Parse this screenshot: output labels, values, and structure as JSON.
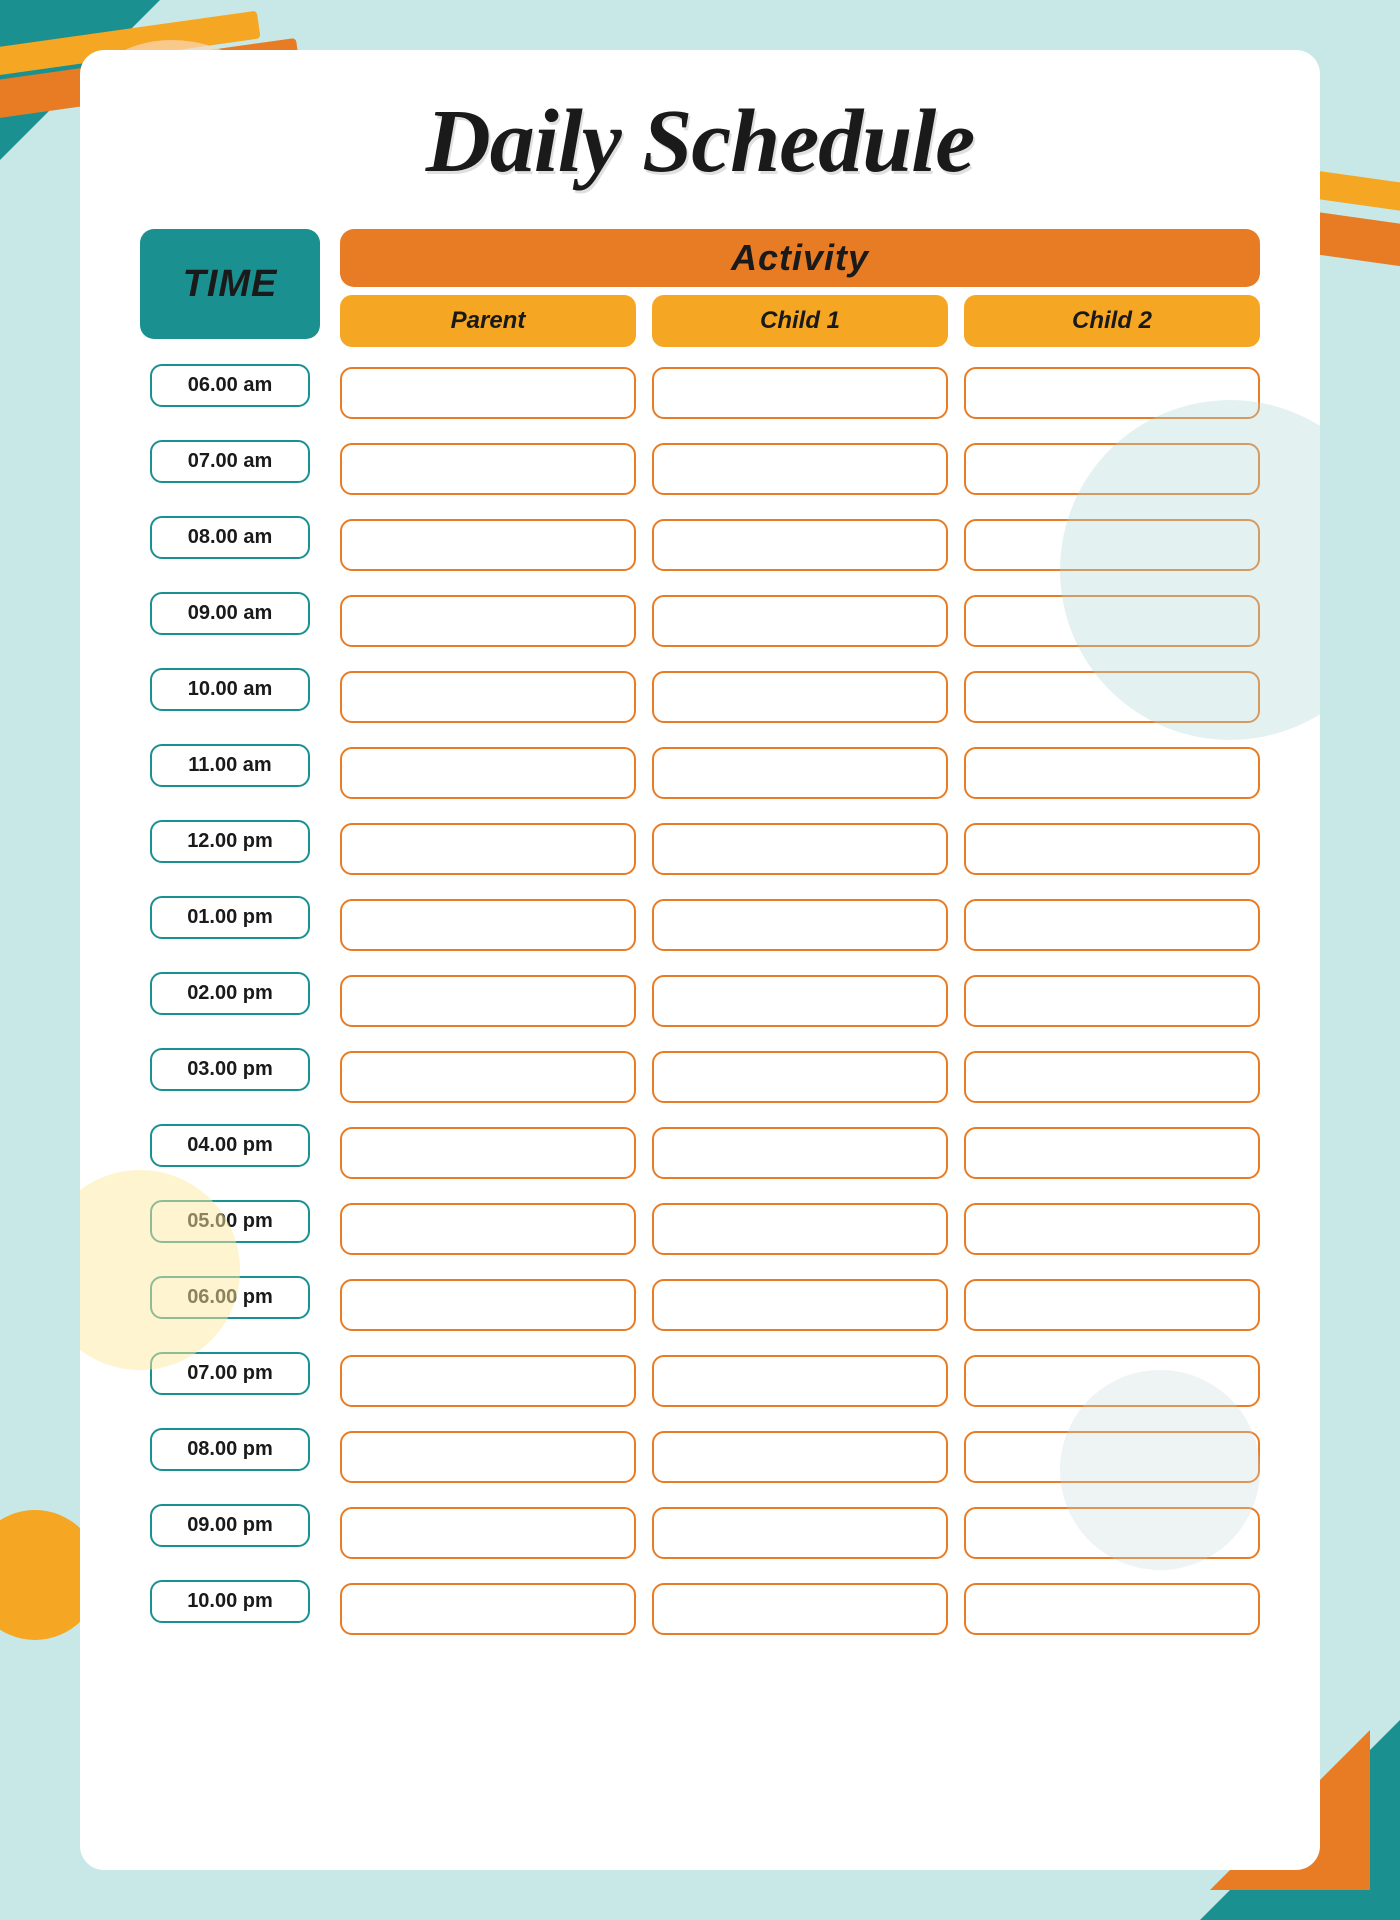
{
  "title": "Daily Schedule",
  "timeHeader": "TIME",
  "activityHeader": "Activity",
  "columns": {
    "parent": "Parent",
    "child1": "Child 1",
    "child2": "Child 2"
  },
  "timeSlots": [
    "06.00 am",
    "07.00 am",
    "08.00 am",
    "09.00 am",
    "10.00 am",
    "11.00 am",
    "12.00 pm",
    "01.00 pm",
    "02.00 pm",
    "03.00 pm",
    "04.00 pm",
    "05.00 pm",
    "06.00 pm",
    "07.00 pm",
    "08.00 pm",
    "09.00 pm",
    "10.00 pm"
  ]
}
